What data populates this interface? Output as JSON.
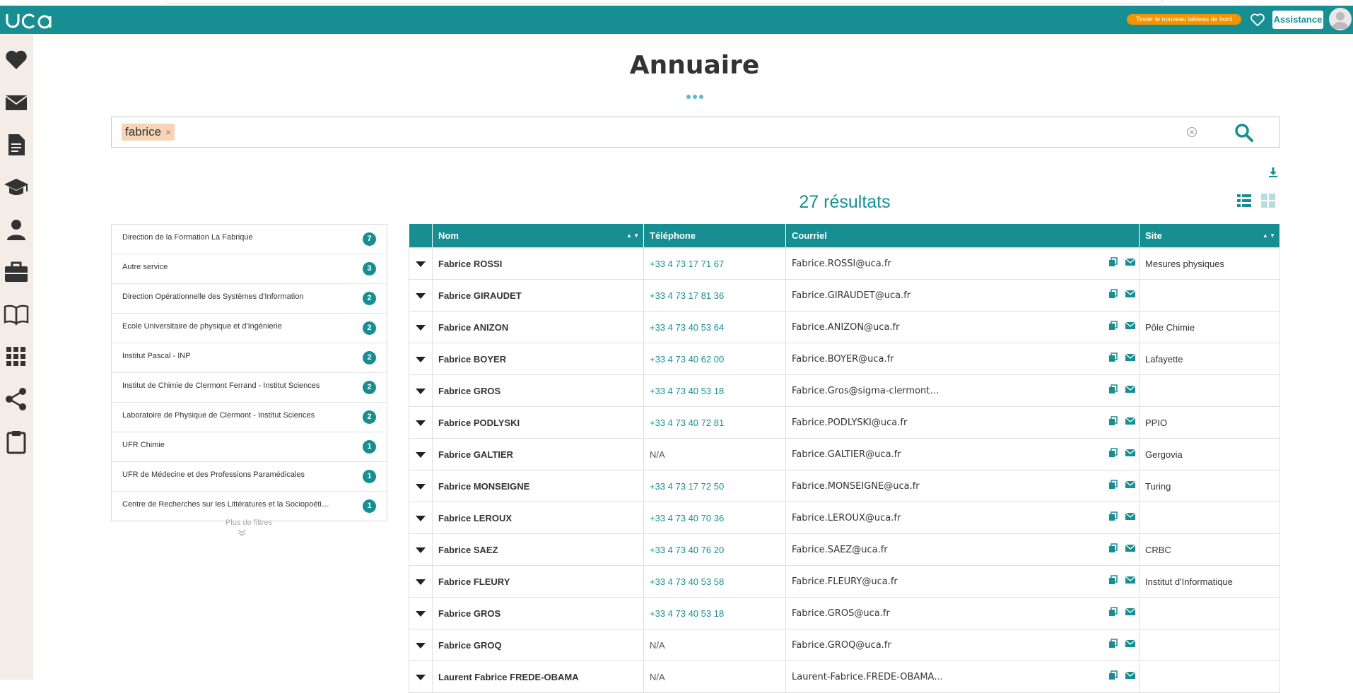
{
  "header": {
    "dashboard_button": "Tester le nouveau tableau de bord",
    "assistance_button": "Assistance",
    "colors": {
      "primary": "#178f92",
      "accent": "#f29400",
      "sidebar": "#f4ece6"
    }
  },
  "sidebar": {
    "icons": [
      "heart-icon",
      "mail-icon",
      "document-icon",
      "graduation-cap-icon",
      "user-icon",
      "briefcase-icon",
      "book-icon",
      "apps-grid-icon",
      "share-icon",
      "clipboard-icon"
    ]
  },
  "page": {
    "title": "Annuaire"
  },
  "search": {
    "chip_value": "fabrice",
    "chip_close": "×"
  },
  "results": {
    "count_text": "27 résultats"
  },
  "filters": {
    "items": [
      {
        "label": "Direction de la Formation La Fabrique",
        "count": "7"
      },
      {
        "label": "Autre service",
        "count": "3"
      },
      {
        "label": "Direction Opérationnelle des Systèmes d'Information",
        "count": "2"
      },
      {
        "label": "Ecole Universitaire de physique et d'Ingénierie",
        "count": "2"
      },
      {
        "label": "Institut Pascal - INP",
        "count": "2"
      },
      {
        "label": "Institut de Chimie de Clermont Ferrand - Institut Sciences",
        "count": "2"
      },
      {
        "label": "Laboratoire de Physique de Clermont - Institut Sciences",
        "count": "2"
      },
      {
        "label": "UFR Chimie",
        "count": "1"
      },
      {
        "label": "UFR de Médecine et des Professions Paramédicales",
        "count": "1"
      },
      {
        "label": "Centre de Recherches sur les Littératures et la Sociopoéti…",
        "count": "1"
      }
    ],
    "more_label": "Plus de filtres"
  },
  "table": {
    "headers": {
      "name": "Nom",
      "phone": "Téléphone",
      "email": "Courriel",
      "site": "Site"
    },
    "sort_glyph": "▲ ▼",
    "rows": [
      {
        "name": "Fabrice ROSSI",
        "phone": "+33 4 73 17 71 67",
        "email": "Fabrice.ROSSI@uca.fr",
        "site": "Mesures physiques"
      },
      {
        "name": "Fabrice GIRAUDET",
        "phone": "+33 4 73 17 81 36",
        "email": "Fabrice.GIRAUDET@uca.fr",
        "site": ""
      },
      {
        "name": "Fabrice ANIZON",
        "phone": "+33 4 73 40 53 64",
        "email": "Fabrice.ANIZON@uca.fr",
        "site": "Pôle Chimie"
      },
      {
        "name": "Fabrice BOYER",
        "phone": "+33 4 73 40 62 00",
        "email": "Fabrice.BOYER@uca.fr",
        "site": "Lafayette"
      },
      {
        "name": "Fabrice GROS",
        "phone": "+33 4 73 40 53 18",
        "email": "Fabrice.Gros@sigma-clermont…",
        "site": ""
      },
      {
        "name": "Fabrice PODLYSKI",
        "phone": "+33 4 73 40 72 81",
        "email": "Fabrice.PODLYSKI@uca.fr",
        "site": "PPIO"
      },
      {
        "name": "Fabrice GALTIER",
        "phone": "N/A",
        "email": "Fabrice.GALTIER@uca.fr",
        "site": "Gergovia"
      },
      {
        "name": "Fabrice MONSEIGNE",
        "phone": "+33 4 73 17 72 50",
        "email": "Fabrice.MONSEIGNE@uca.fr",
        "site": "Turing"
      },
      {
        "name": "Fabrice LEROUX",
        "phone": "+33 4 73 40 70 36",
        "email": "Fabrice.LEROUX@uca.fr",
        "site": ""
      },
      {
        "name": "Fabrice SAEZ",
        "phone": "+33 4 73 40 76 20",
        "email": "Fabrice.SAEZ@uca.fr",
        "site": "CRBC"
      },
      {
        "name": "Fabrice FLEURY",
        "phone": "+33 4 73 40 53 58",
        "email": "Fabrice.FLEURY@uca.fr",
        "site": "Institut d'Informatique"
      },
      {
        "name": "Fabrice GROS",
        "phone": "+33 4 73 40 53 18",
        "email": "Fabrice.GROS@uca.fr",
        "site": ""
      },
      {
        "name": "Fabrice GROQ",
        "phone": "N/A",
        "email": "Fabrice.GROQ@uca.fr",
        "site": ""
      },
      {
        "name": "Laurent Fabrice FREDE-OBAMA",
        "phone": "N/A",
        "email": "Laurent-Fabrice.FREDE-OBAMA…",
        "site": ""
      }
    ]
  }
}
